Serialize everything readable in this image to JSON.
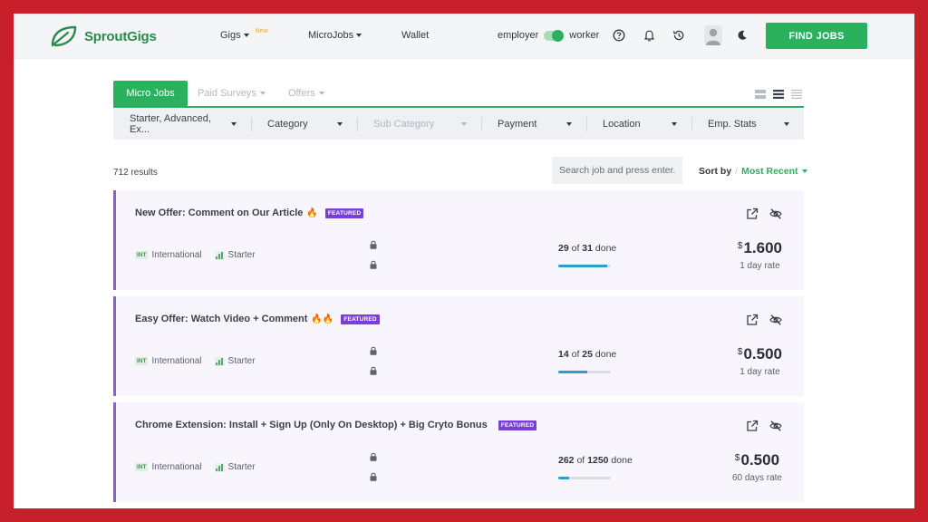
{
  "header": {
    "brand": "SproutGigs",
    "nav": [
      {
        "label": "Gigs",
        "badge": "New"
      },
      {
        "label": "MicroJobs"
      },
      {
        "label": "Wallet"
      }
    ],
    "mode_left": "employer",
    "mode_right": "worker",
    "find_jobs": "FIND JOBS",
    "accent": "#2ab15d"
  },
  "tabs": [
    {
      "label": "Micro Jobs",
      "active": true
    },
    {
      "label": "Paid Surveys",
      "active": false
    },
    {
      "label": "Offers",
      "active": false
    }
  ],
  "filters": [
    {
      "label": "Starter, Advanced, Ex...",
      "enabled": true
    },
    {
      "label": "Category",
      "enabled": true
    },
    {
      "label": "Sub Category",
      "enabled": false
    },
    {
      "label": "Payment",
      "enabled": true
    },
    {
      "label": "Location",
      "enabled": true
    },
    {
      "label": "Emp. Stats",
      "enabled": true
    }
  ],
  "results": {
    "count_text": "712 results",
    "search_placeholder": "Search job and press enter...",
    "sort_label": "Sort by",
    "sort_value": "Most Recent"
  },
  "jobs": [
    {
      "title": "New Offer: Comment on Our Article",
      "emoji": "🔥",
      "badge": "FEATURED",
      "region_code": "INT",
      "region": "International",
      "level": "Starter",
      "done": "29",
      "total": "31",
      "progress_fraction": 0.935,
      "currency": "$",
      "price": "1.600",
      "rate": "1 day rate"
    },
    {
      "title": "Easy Offer: Watch Video + Comment",
      "emoji": "🔥🔥",
      "badge": "FEATURED",
      "region_code": "INT",
      "region": "International",
      "level": "Starter",
      "done": "14",
      "total": "25",
      "progress_fraction": 0.56,
      "currency": "$",
      "price": "0.500",
      "rate": "1 day rate"
    },
    {
      "title": "Chrome Extension: Install + Sign Up (Only On Desktop) + Big Cryto Bonus",
      "emoji": "",
      "badge": "FEATURED",
      "region_code": "INT",
      "region": "International",
      "level": "Starter",
      "done": "262",
      "total": "1250",
      "progress_fraction": 0.21,
      "currency": "$",
      "price": "0.500",
      "rate": "60 days rate"
    }
  ],
  "labels": {
    "of": "of",
    "done": "done"
  }
}
